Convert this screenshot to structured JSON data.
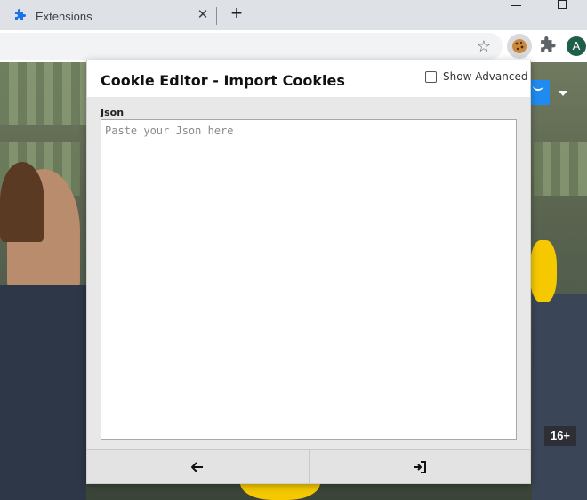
{
  "browser": {
    "tab": {
      "title": "Extensions",
      "icon": "puzzle-icon"
    },
    "new_tab_symbol": "+",
    "close_tab_symbol": "✕",
    "avatar_letter": "A"
  },
  "page": {
    "rating": "16+"
  },
  "popup": {
    "title": "Cookie Editor - Import Cookies",
    "show_advanced_label": "Show Advanced",
    "show_advanced_checked": false,
    "json_label": "Json",
    "json_placeholder": "Paste your Json here",
    "json_value": "",
    "footer": {
      "back_icon": "arrow-left-icon",
      "import_icon": "import-icon"
    }
  }
}
